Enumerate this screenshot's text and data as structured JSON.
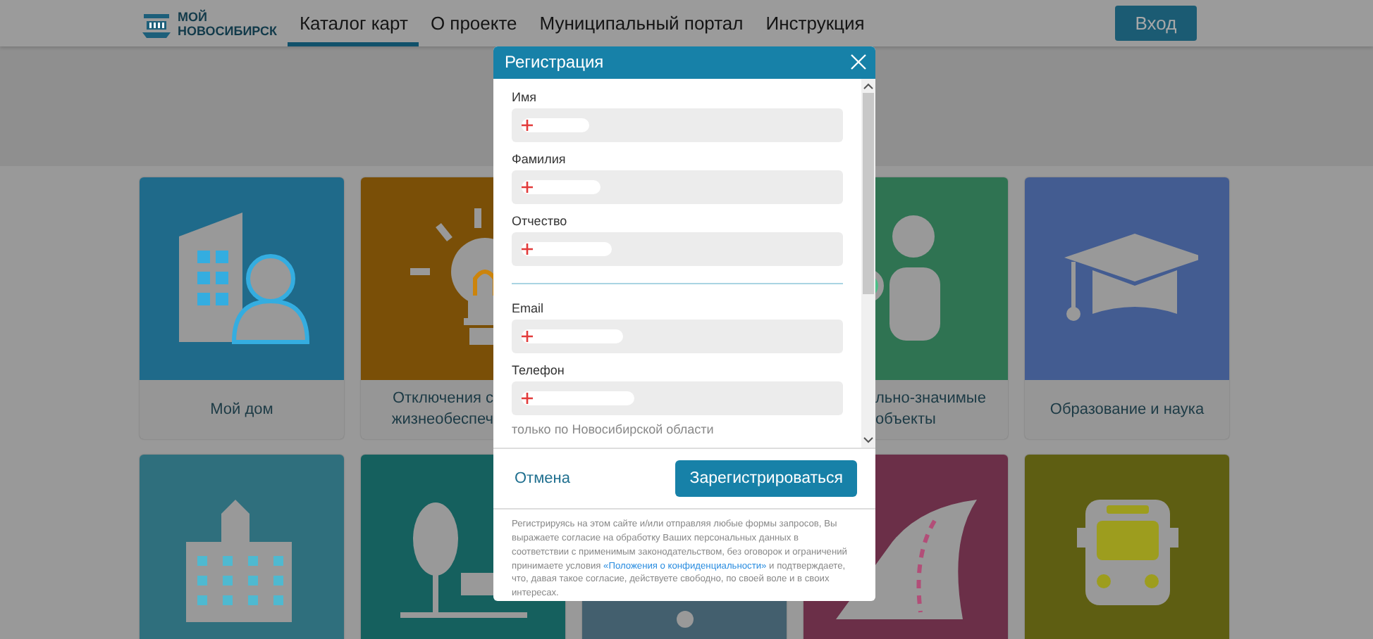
{
  "header": {
    "logo_lines": [
      "МОЙ",
      "НОВОСИБИРСК"
    ],
    "nav": [
      {
        "label": "Каталог карт",
        "selected": true
      },
      {
        "label": "О проекте",
        "selected": false
      },
      {
        "label": "Муниципальный портал",
        "selected": false
      },
      {
        "label": "Инструкция",
        "selected": false
      }
    ],
    "login_button": "Вход"
  },
  "tile_rows": [
    [
      {
        "color": "#1f6a8a",
        "caption": [
          "Мой дом"
        ]
      },
      {
        "color": "#7a4f07",
        "caption": [
          "Отключения с",
          "жизнеобеспеч"
        ]
      },
      null,
      {
        "color": "#2f7352",
        "caption": [
          "льно-значимые",
          "объекты"
        ]
      },
      {
        "color": "#435c91",
        "caption": [
          "Образование и наука"
        ]
      }
    ],
    [
      {
        "color": "#2f6f7d"
      },
      {
        "color": "#15605e"
      },
      {
        "color": "#435f6e"
      },
      {
        "color": "#6b2f48"
      },
      {
        "color": "#5e5e12"
      }
    ]
  ],
  "modal": {
    "title": "Регистрация",
    "fields": [
      {
        "label": "Имя"
      },
      {
        "label": "Фамилия"
      },
      {
        "label": "Отчество"
      },
      {
        "label": "Email"
      },
      {
        "label": "Телефон",
        "hint": "только по Новосибирской области"
      }
    ],
    "cancel": "Отмена",
    "submit": "Зарегистрироваться",
    "consent": "Регистрируясь на этом сайте и/или отправляя любые формы запросов, Вы выражаете согласие на обработку Ваших персональных данных в соответствии с применимым законодательством, без оговорок и ограничений принимаете условия ",
    "consent_link": "«Положения о конфиденциальности»",
    "consent_end": " и подтверждаете, что, давая такое согласие, действуете свободно, по своей воле и в своих интересах."
  }
}
